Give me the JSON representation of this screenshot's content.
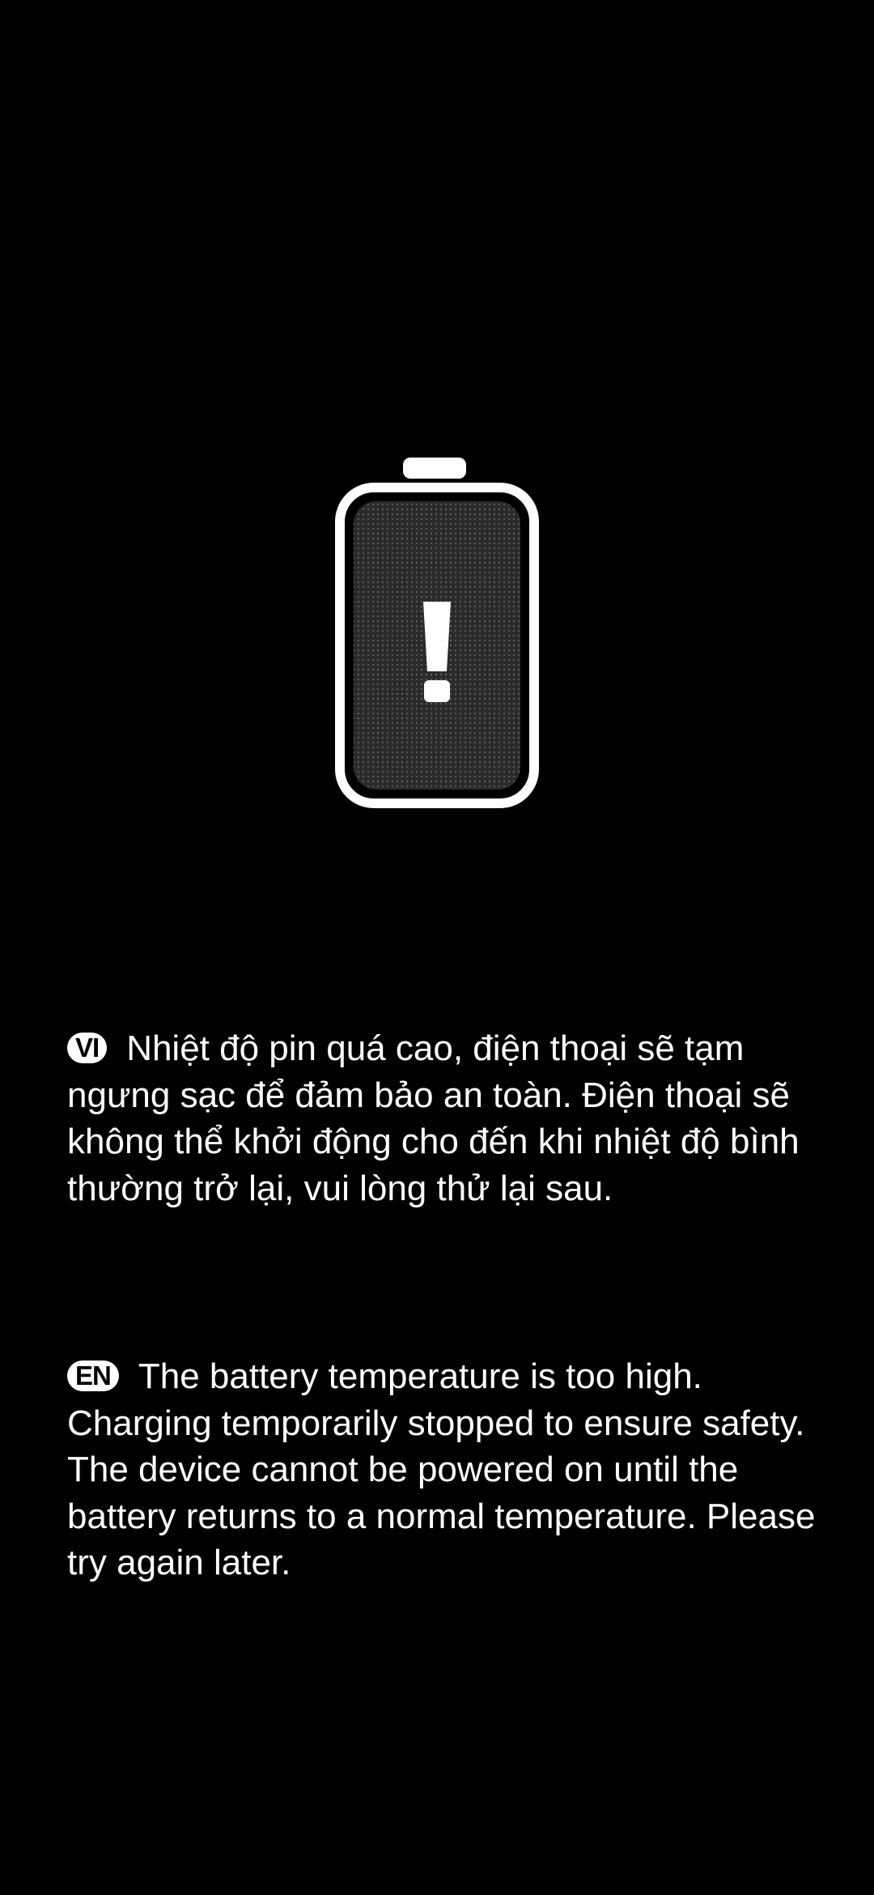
{
  "battery_warning": {
    "icon": "battery-overheat-warning-icon",
    "colors": {
      "background": "#000000",
      "text": "#ffffff",
      "battery_fill": "#2a2a2a"
    }
  },
  "messages": [
    {
      "lang_badge": "VI",
      "text": "Nhiệt độ pin quá cao, điện thoại sẽ tạm ngưng sạc để đảm bảo an toàn. Điện thoại sẽ không thể khởi động cho đến khi nhiệt độ bình thường trở lại, vui lòng thử lại sau."
    },
    {
      "lang_badge": "EN",
      "text": "The battery temperature is too high. Charging temporarily stopped to ensure safety. The device cannot be powered on until the battery returns to a normal temperature. Please try again later."
    }
  ]
}
